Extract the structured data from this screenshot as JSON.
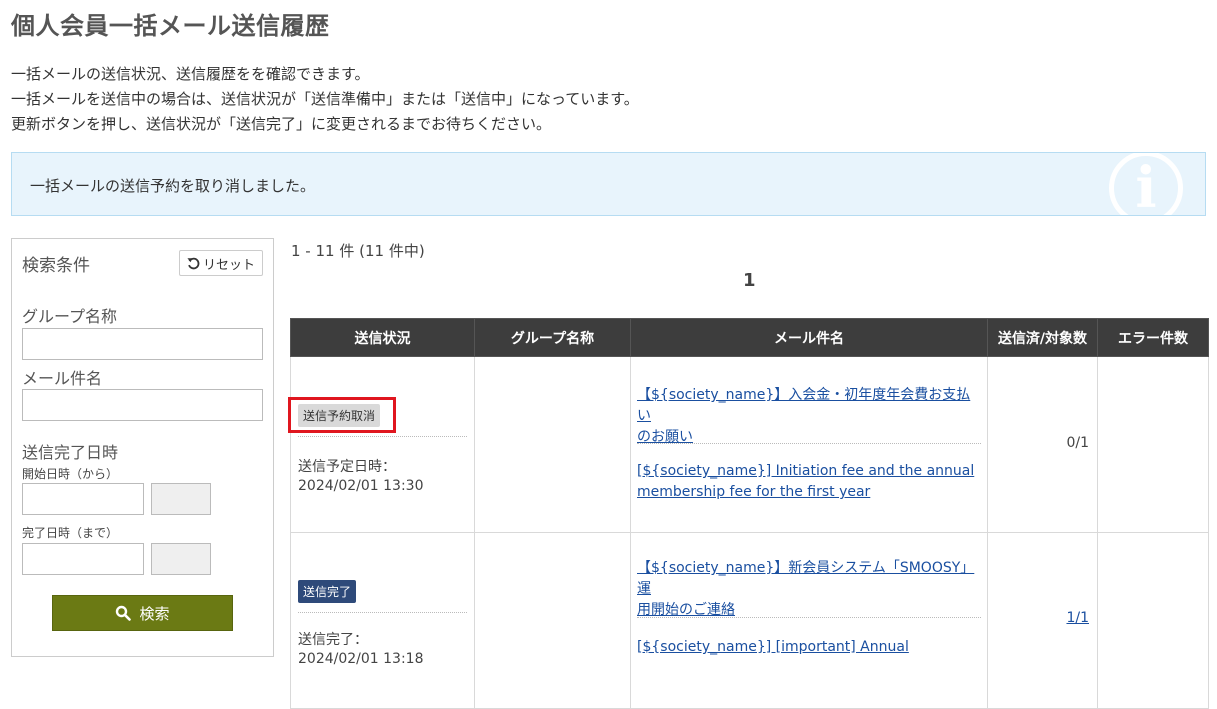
{
  "page": {
    "title": "個人会員一括メール送信履歴",
    "description": [
      "一括メールの送信状況、送信履歴をを確認できます。",
      "一括メールを送信中の場合は、送信状況が「送信準備中」または「送信中」になっています。",
      "更新ボタンを押し、送信状況が「送信完了」に変更されるまでお待ちください。"
    ]
  },
  "info": {
    "message": "一括メールの送信予約を取り消しました。",
    "icon": "info-icon"
  },
  "search": {
    "title": "検索条件",
    "reset_label": "リセット",
    "group_name_label": "グループ名称",
    "group_name_value": "",
    "mail_subject_label": "メール件名",
    "mail_subject_value": "",
    "completed_datetime_label": "送信完了日時",
    "start_label": "開始日時（から）",
    "end_label": "完了日時（まで）",
    "search_label": "検索"
  },
  "results": {
    "count_text": "1 - 11 件 (11 件中)",
    "page": "1"
  },
  "table": {
    "headers": [
      "送信状況",
      "グループ名称",
      "メール件名",
      "送信済/対象数",
      "エラー件数"
    ],
    "rows": [
      {
        "status": "送信予約取消",
        "time_label": "送信予定日時：",
        "time_value": "2024/02/01 13:30",
        "group": "",
        "subject_ja_1": "【${society_name}】入会金・初年度年会費お支払い",
        "subject_ja_2": "のお願い",
        "subject_en_1": "[${society_name}] Initiation fee and the annual",
        "subject_en_2": "membership fee for the first year",
        "sent": "0/1",
        "errors": ""
      },
      {
        "status": "送信完了",
        "time_label": "送信完了：",
        "time_value": "2024/02/01 13:18",
        "group": "",
        "subject_ja_1": "【${society_name}】新会員システム「SMOOSY」運",
        "subject_ja_2": "用開始のご連絡",
        "subject_en_1": "[${society_name}] [important] Annual",
        "sent": "1/1",
        "errors": ""
      }
    ]
  },
  "colors": {
    "search_button": "#6b7a14",
    "header_bg": "#3d3d3d",
    "link": "#1a4fa0",
    "highlight": "#e0161f"
  }
}
